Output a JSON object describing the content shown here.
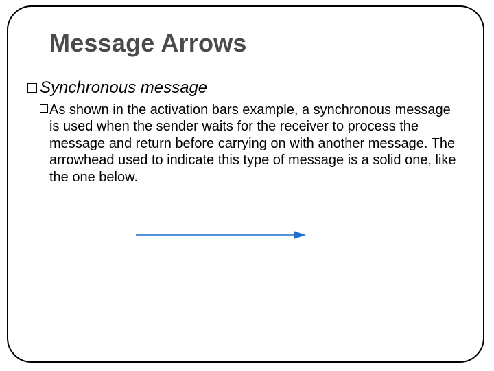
{
  "slide": {
    "title": "Message Arrows",
    "heading": "Synchronous message",
    "body": "As shown in the activation bars example, a synchronous message is used when the sender waits for the receiver to process the message and return before carrying on with another message.  The arrowhead used to indicate this type of message is a solid one, like the one below."
  },
  "arrow": {
    "color": "#1f6fd1",
    "line_width": 1.6
  }
}
